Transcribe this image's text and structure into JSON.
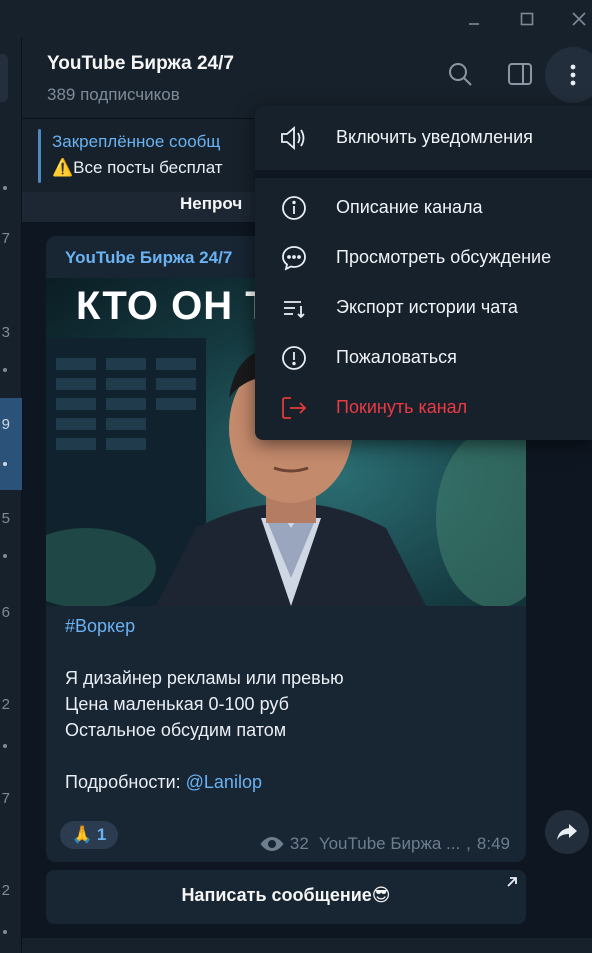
{
  "channel": {
    "title": "YouTube Биржа 24/7",
    "subscribers": "389 подписчиков"
  },
  "pinned": {
    "title": "Закреплённое сообщ",
    "text": "⚠️Все посты бесплат"
  },
  "unread_banner": "Непроч",
  "sidebar_digits": [
    "7",
    "3",
    "9",
    "5",
    "6",
    "2",
    "7",
    "2"
  ],
  "post": {
    "author": "YouTube Биржа 24/7",
    "image_headline": "КТО ОН Т",
    "hashtag": "#Воркер",
    "lines": [
      "Я дизайнер рекламы или превью",
      "Цена маленькая 0-100 руб",
      "Остальное обсудим патом"
    ],
    "details_label": "Подробности: ",
    "details_link": "@Lanilop",
    "reaction": {
      "emoji": "🙏",
      "count": "1"
    },
    "views": "32",
    "signature": "YouTube Биржа ...",
    "time": "8:49"
  },
  "comment_button": "Написать сообщение😎",
  "menu": {
    "items": [
      {
        "label": "Включить уведомления",
        "icon": "speaker-icon"
      },
      {
        "label": "Описание канала",
        "icon": "info-icon"
      },
      {
        "label": "Просмотреть обсуждение",
        "icon": "chat-bubble-icon"
      },
      {
        "label": "Экспорт истории чата",
        "icon": "export-list-icon"
      },
      {
        "label": "Пожаловаться",
        "icon": "report-icon"
      },
      {
        "label": "Покинуть канал",
        "icon": "leave-icon",
        "danger": true
      }
    ]
  },
  "colors": {
    "background": "#0e1621",
    "panel": "#17212b",
    "accent": "#6ab2f2",
    "danger": "#ec3942",
    "bubble": "#182533"
  }
}
